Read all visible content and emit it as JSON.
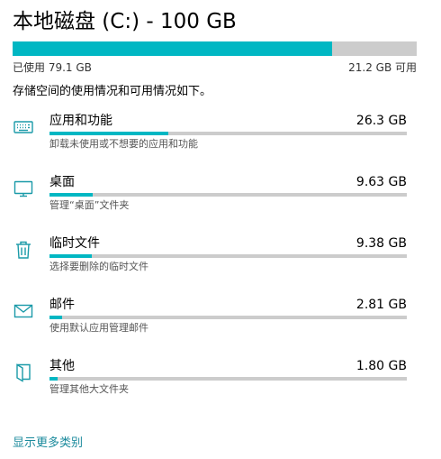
{
  "header": {
    "title": "本地磁盘 (C:) - 100 GB"
  },
  "usage": {
    "used_label": "已使用 79.1 GB",
    "free_label": "21.2 GB 可用",
    "used_gb": 79.1,
    "total_gb": 100
  },
  "intro_text": "存储空间的使用情况和可用情况如下。",
  "categories": [
    {
      "name": "应用和功能",
      "size": "26.3 GB",
      "description": "卸载未使用或不想要的应用和功能",
      "icon": "keyboard-icon",
      "fraction": 0.333
    },
    {
      "name": "桌面",
      "size": "9.63 GB",
      "description": "管理“桌面”文件夹",
      "icon": "monitor-icon",
      "fraction": 0.122
    },
    {
      "name": "临时文件",
      "size": "9.38 GB",
      "description": "选择要删除的临时文件",
      "icon": "trash-icon",
      "fraction": 0.119
    },
    {
      "name": "邮件",
      "size": "2.81 GB",
      "description": "使用默认应用管理邮件",
      "icon": "mail-icon",
      "fraction": 0.036
    },
    {
      "name": "其他",
      "size": "1.80 GB",
      "description": "管理其他大文件夹",
      "icon": "folder-icon",
      "fraction": 0.023
    }
  ],
  "more_link": "显示更多类别",
  "colors": {
    "accent": "#00b7c3",
    "track": "#cccccc",
    "link": "#1a8a9c"
  }
}
